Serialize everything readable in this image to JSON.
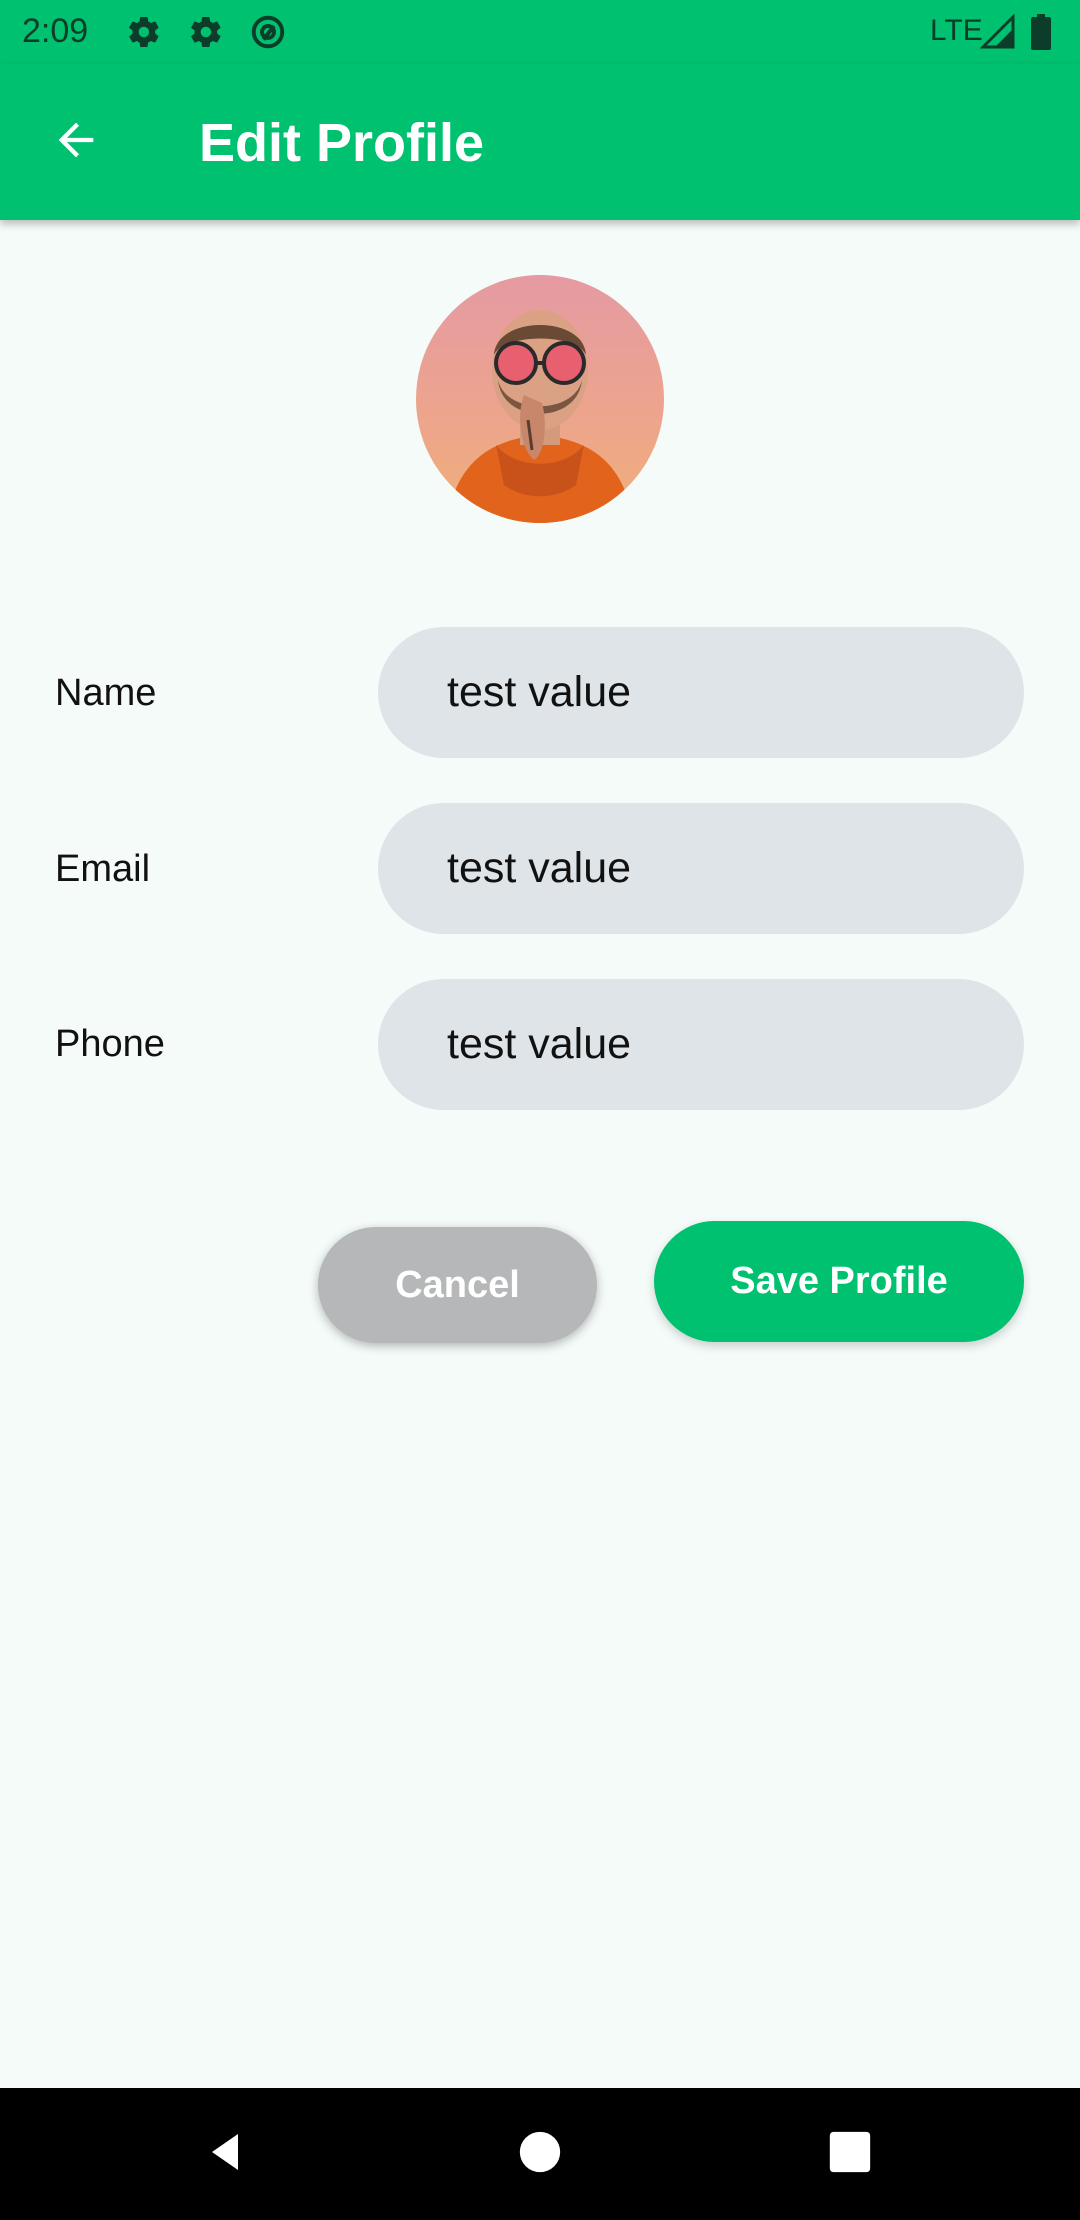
{
  "status_bar": {
    "time": "2:09",
    "network": "LTE",
    "icons": [
      "settings-icon",
      "settings-icon",
      "at-sign-icon",
      "signal-icon",
      "battery-icon"
    ]
  },
  "app_bar": {
    "title": "Edit Profile",
    "back_icon": "arrow-left-icon"
  },
  "profile": {
    "avatar": "profile-photo"
  },
  "form": {
    "fields": [
      {
        "label": "Name",
        "value": "test value"
      },
      {
        "label": "Email",
        "value": "test value"
      },
      {
        "label": "Phone",
        "value": "test value"
      }
    ]
  },
  "actions": {
    "cancel_label": "Cancel",
    "save_label": "Save Profile"
  },
  "nav_bar": {
    "icons": [
      "back-triangle-icon",
      "home-circle-icon",
      "recents-square-icon"
    ]
  },
  "colors": {
    "primary": "#00c170",
    "background": "#f5fbf9",
    "field": "#dfe4e8",
    "cancel": "#b5b7b8"
  }
}
